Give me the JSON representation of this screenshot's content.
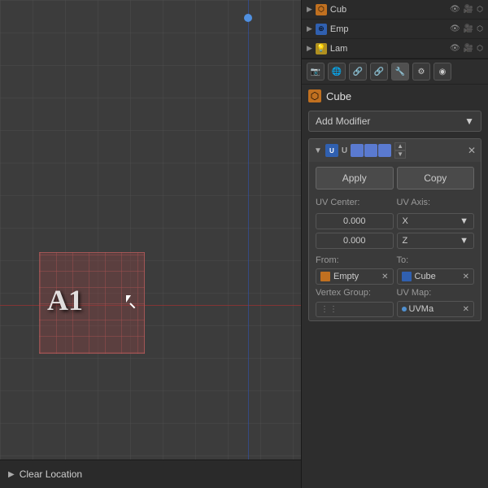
{
  "viewport": {
    "object_label": "A1"
  },
  "outliner": {
    "items": [
      {
        "name": "Cub",
        "icon_type": "cube",
        "visible": true
      },
      {
        "name": "Emp",
        "icon_type": "empty",
        "visible": true
      },
      {
        "name": "Lam",
        "icon_type": "lamp",
        "visible": true
      }
    ]
  },
  "properties": {
    "title": "Cube",
    "add_modifier_label": "Add Modifier",
    "modifier": {
      "apply_label": "Apply",
      "copy_label": "Copy",
      "uv_center_label": "UV Center:",
      "uv_center_x": "0.000",
      "uv_center_y": "0.000",
      "uv_axis_label": "UV Axis:",
      "uv_axis_x": "X",
      "uv_axis_z": "Z",
      "from_label": "From:",
      "to_label": "To:",
      "from_value": "Empty",
      "to_value": "Cube",
      "vertex_group_label": "Vertex Group:",
      "uv_map_label": "UV Map:",
      "uv_map_value": "UVMa"
    }
  },
  "bottom_bar": {
    "label": "Clear Location"
  }
}
